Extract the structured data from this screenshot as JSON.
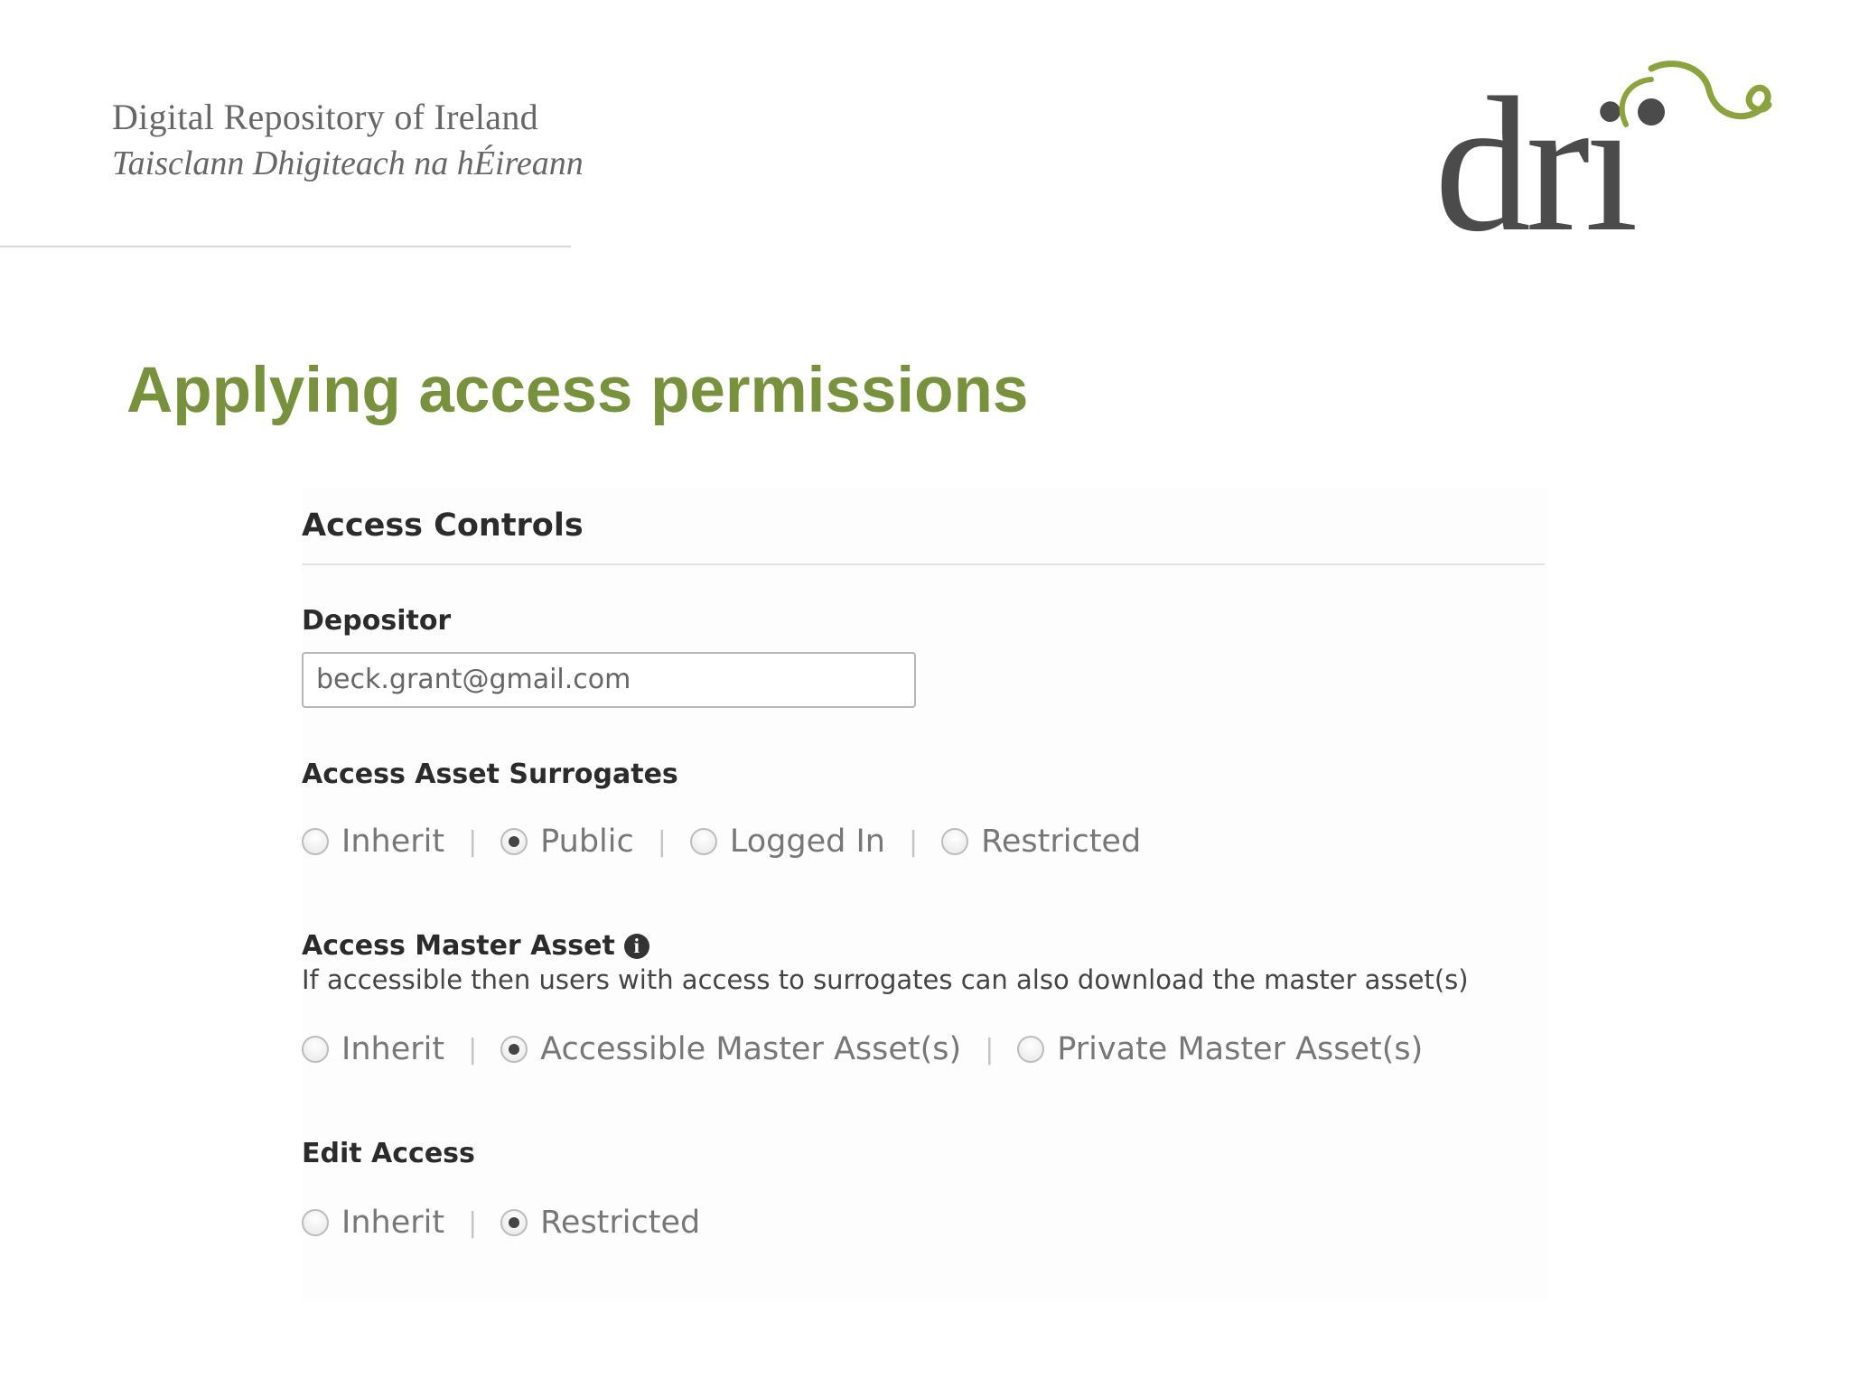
{
  "header": {
    "org_name_en": "Digital Repository of Ireland",
    "org_name_ga": "Taisclann Dhigiteach na hÉireann",
    "logo_text": "dri"
  },
  "slide": {
    "title": "Applying access permissions"
  },
  "form": {
    "panel_title": "Access Controls",
    "depositor": {
      "label": "Depositor",
      "value": "beck.grant@gmail.com"
    },
    "surrogates": {
      "label": "Access Asset Surrogates",
      "options": [
        "Inherit",
        "Public",
        "Logged In",
        "Restricted"
      ],
      "selected": "Public"
    },
    "master_asset": {
      "label": "Access Master Asset",
      "info_icon": "info-icon",
      "help": "If accessible then users with access to surrogates can also download the master asset(s)",
      "options": [
        "Inherit",
        "Accessible Master Asset(s)",
        "Private Master Asset(s)"
      ],
      "selected": "Accessible Master Asset(s)"
    },
    "edit_access": {
      "label": "Edit Access",
      "options": [
        "Inherit",
        "Restricted"
      ],
      "selected": "Restricted"
    },
    "separator": "|"
  },
  "colors": {
    "title_green": "#77923a",
    "logo_grey": "#4b4b4b",
    "logo_green": "#8aa33a"
  }
}
